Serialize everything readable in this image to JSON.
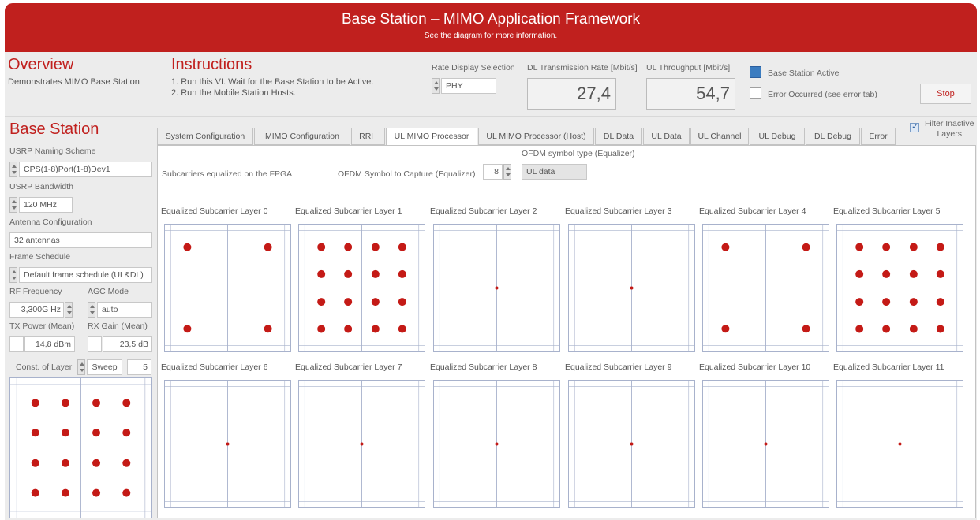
{
  "header": {
    "title": "Base Station – MIMO Application Framework",
    "subtitle": "See the diagram for more information."
  },
  "overview": {
    "title": "Overview",
    "description": "Demonstrates MIMO Base Station"
  },
  "instructions": {
    "title": "Instructions",
    "lines": [
      "1. Run this VI. Wait for the Base Station to be Active.",
      "2. Run the Mobile Station Hosts."
    ]
  },
  "rate_display": {
    "label": "Rate Display Selection",
    "value": "PHY"
  },
  "dl_rate": {
    "label": "DL Transmission Rate [Mbit/s]",
    "value": "27,4"
  },
  "ul_throughput": {
    "label": "UL Throughput [Mbit/s]",
    "value": "54,7"
  },
  "status": {
    "base_station_active_label": "Base Station Active",
    "base_station_active_color": "#3b7cc0",
    "error_label": "Error Occurred (see error tab)"
  },
  "stop_button": {
    "label": "Stop"
  },
  "base_station": {
    "title": "Base Station",
    "usrp_naming": {
      "label": "USRP Naming Scheme",
      "value": "CPS(1-8)Port(1-8)Dev1"
    },
    "usrp_bandwidth": {
      "label": "USRP Bandwidth",
      "value": "120 MHz"
    },
    "antenna_config": {
      "label": "Antenna Configuration",
      "value": "32 antennas"
    },
    "frame_schedule": {
      "label": "Frame Schedule",
      "value": "Default frame schedule (UL&DL)"
    },
    "rf_frequency": {
      "label": "RF Frequency",
      "value": "3,300G Hz"
    },
    "agc_mode": {
      "label": "AGC Mode",
      "value": "auto"
    },
    "tx_power": {
      "label": "TX Power (Mean)",
      "value": "14,8 dBm"
    },
    "rx_gain": {
      "label": "RX Gain (Mean)",
      "value": "23,5 dB"
    },
    "const_of_layer": {
      "label": "Const. of Layer",
      "mode": "Sweep",
      "value": "5"
    }
  },
  "tabs": [
    {
      "label": "System Configuration",
      "active": false
    },
    {
      "label": "MIMO Configuration",
      "active": false
    },
    {
      "label": "RRH",
      "active": false
    },
    {
      "label": "UL MIMO Processor",
      "active": true
    },
    {
      "label": "UL MIMO Processor (Host)",
      "active": false
    },
    {
      "label": "DL Data",
      "active": false
    },
    {
      "label": "UL Data",
      "active": false
    },
    {
      "label": "UL Channel",
      "active": false
    },
    {
      "label": "UL Debug",
      "active": false
    },
    {
      "label": "DL Debug",
      "active": false
    },
    {
      "label": "Error",
      "active": false
    }
  ],
  "filter_inactive": {
    "label_line1": "Filter Inactive",
    "label_line2": "Layers",
    "checked": true
  },
  "processor": {
    "subcarriers_label": "Subcarriers equalized on the FPGA",
    "ofdm_capture_label": "OFDM Symbol to Capture (Equalizer)",
    "ofdm_capture_value": "8",
    "ofdm_type_label": "OFDM symbol type (Equalizer)",
    "ofdm_type_value": "UL data"
  },
  "layer_titles": [
    "Equalized Subcarrier Layer 0",
    "Equalized Subcarrier Layer 1",
    "Equalized Subcarrier Layer 2",
    "Equalized Subcarrier Layer 3",
    "Equalized Subcarrier Layer 4",
    "Equalized Subcarrier Layer 5",
    "Equalized Subcarrier Layer 6",
    "Equalized Subcarrier Layer 7",
    "Equalized Subcarrier Layer 8",
    "Equalized Subcarrier Layer 9",
    "Equalized Subcarrier Layer 10",
    "Equalized Subcarrier Layer 11"
  ],
  "constellations": {
    "layer_modulation": [
      "qpsk",
      "16qam",
      "none",
      "none",
      "qpsk",
      "16qam",
      "none",
      "none",
      "none",
      "none",
      "none",
      "none"
    ],
    "point_color": "#c41a16",
    "grid_color": "#a8b2cc"
  }
}
